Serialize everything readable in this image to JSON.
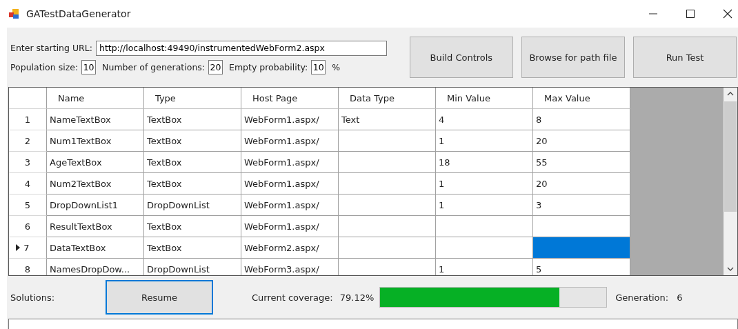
{
  "window": {
    "title": "GATestDataGenerator"
  },
  "url": {
    "label": "Enter starting URL:",
    "value": "http://localhost:49490/instrumentedWebForm2.aspx"
  },
  "params": [
    {
      "label": "Population size:",
      "value": "10"
    },
    {
      "label": "Number of generations:",
      "value": "20"
    },
    {
      "label": "Empty probability:",
      "value": "10",
      "suffix": "%"
    }
  ],
  "buttons": [
    "Build Controls",
    "Browse for path file",
    "Run Test"
  ],
  "table": {
    "columns": [
      "Name",
      "Type",
      "Host Page",
      "Data Type",
      "Min Value",
      "Max Value"
    ],
    "rows": [
      {
        "number": "1",
        "cells": [
          "NameTextBox",
          "TextBox",
          "WebForm1.aspx/",
          "Text",
          "4",
          "8"
        ],
        "selected": false
      },
      {
        "number": "2",
        "cells": [
          "Num1TextBox",
          "TextBox",
          "WebForm1.aspx/",
          "",
          "1",
          "20"
        ],
        "selected": false
      },
      {
        "number": "3",
        "cells": [
          "AgeTextBox",
          "TextBox",
          "WebForm1.aspx/",
          "",
          "18",
          "55"
        ],
        "selected": false
      },
      {
        "number": "4",
        "cells": [
          "Num2TextBox",
          "TextBox",
          "WebForm1.aspx/",
          "",
          "1",
          "20"
        ],
        "selected": false
      },
      {
        "number": "5",
        "cells": [
          "DropDownList1",
          "DropDownList",
          "WebForm1.aspx/",
          "",
          "1",
          "3"
        ],
        "selected": false
      },
      {
        "number": "6",
        "cells": [
          "ResultTextBox",
          "TextBox",
          "WebForm1.aspx/",
          "",
          "",
          ""
        ],
        "selected": false
      },
      {
        "number": "7",
        "cells": [
          "DataTextBox",
          "TextBox",
          "WebForm2.aspx/",
          "",
          "",
          ""
        ],
        "selected": true
      },
      {
        "number": "8",
        "cells": [
          "NamesDropDow...",
          "DropDownList",
          "WebForm3.aspx/",
          "",
          "1",
          "5"
        ],
        "selected": false
      }
    ]
  },
  "bottom": {
    "solutions_label": "Solutions:",
    "resume_button": "Resume",
    "coverage_label": "Current coverage:",
    "coverage_value": "79.12%",
    "coverage": {
      "level": 0.7912
    },
    "generation_label": "Generation:",
    "generation_value": "6"
  }
}
